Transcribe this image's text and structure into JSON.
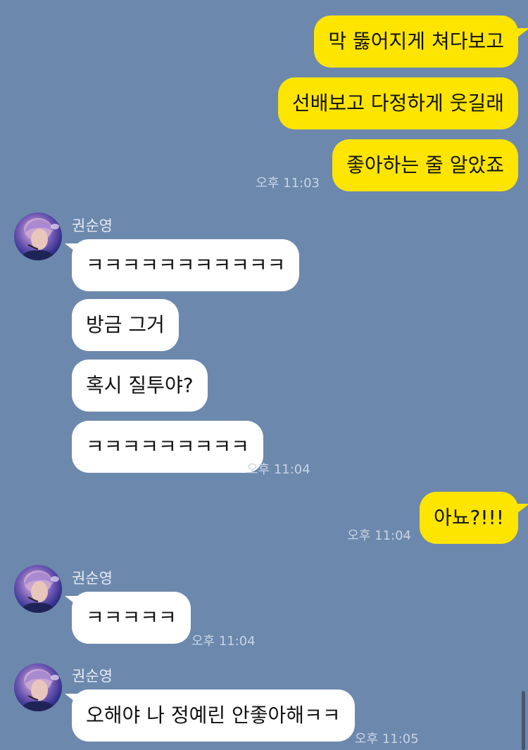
{
  "messages": [
    {
      "sender": "me",
      "text": "막 뚫어지게 쳐다보고"
    },
    {
      "sender": "me",
      "text": "선배보고 다정하게 웃길래"
    },
    {
      "sender": "me",
      "text": "좋아하는 줄 알았죠",
      "time": "오후 11:03"
    },
    {
      "sender": "other",
      "name": "권순영",
      "text": "ㅋㅋㅋㅋㅋㅋㅋㅋㅋㅋㅋ"
    },
    {
      "sender": "other",
      "text": "방금 그거"
    },
    {
      "sender": "other",
      "text": "혹시 질투야?"
    },
    {
      "sender": "other",
      "text": "ㅋㅋㅋㅋㅋㅋㅋㅋㅋ",
      "time": "오후 11:04"
    },
    {
      "sender": "me",
      "text": "아뇨?!!!",
      "time": "오후 11:04"
    },
    {
      "sender": "other",
      "name": "권순영",
      "text": "ㅋㅋㅋㅋㅋ",
      "time": "오후 11:04"
    },
    {
      "sender": "other",
      "name": "권순영",
      "text": "오해야 나 정예린 안좋아해ㅋㅋ",
      "time": "오후 11:05"
    }
  ],
  "colors": {
    "background": "#6c88ad",
    "my_bubble": "#fee500",
    "their_bubble": "#ffffff"
  }
}
